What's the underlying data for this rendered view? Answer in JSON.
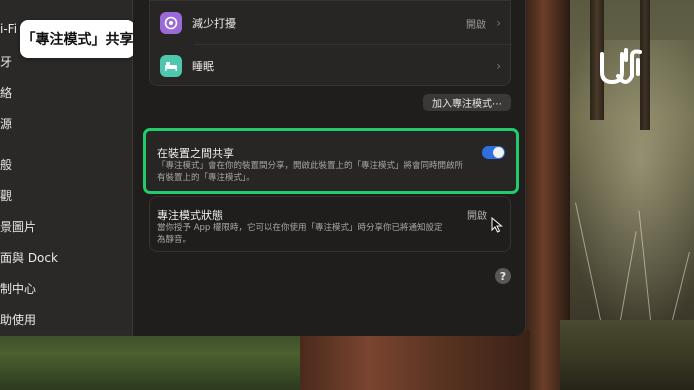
{
  "sidebar": {
    "tooltip": "「專注模式」共享",
    "items": [
      {
        "label": "i-Fi"
      },
      {
        "label": "牙"
      },
      {
        "label": "絡"
      },
      {
        "label": "源"
      },
      {
        "label": "般"
      },
      {
        "label": "觀"
      },
      {
        "label": "景圖片"
      },
      {
        "label": "面與 Dock"
      },
      {
        "label": "制中心"
      },
      {
        "label": "助使用"
      }
    ]
  },
  "focus_list": {
    "items": [
      {
        "label": "減少打擾",
        "value": "開啟",
        "icon": "flower-icon",
        "icon_color": "#9a6ad8"
      },
      {
        "label": "睡眠",
        "value": "",
        "icon": "bed-icon",
        "icon_color": "#4fc7ae"
      }
    ],
    "add_button": "加入專注模式⋯"
  },
  "share_across_devices": {
    "title": "在裝置之間共享",
    "description": "「專注模式」會在你的裝置間分享，開啟此裝置上的「專注模式」將會同時開啟所有裝置上的「專注模式」。",
    "toggle_on": true,
    "highlight_color": "#21cc6a"
  },
  "focus_status": {
    "title": "專注模式狀態",
    "value": "開啟",
    "description": "當你授予 App 權限時，它可以在你使用「專注模式」時分享你已將通知設定為靜音。"
  },
  "help_label": "?",
  "colors": {
    "accent": "#2f6fe0",
    "highlight": "#21cc6a"
  }
}
